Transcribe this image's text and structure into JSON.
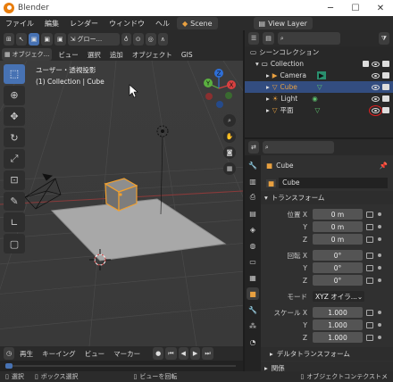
{
  "window": {
    "title": "Blender",
    "min": "─",
    "max": "☐",
    "close": "✕"
  },
  "menubar": {
    "items": [
      "ファイル",
      "編集",
      "レンダー",
      "ウィンドウ",
      "ヘル"
    ],
    "workspace": "Scene",
    "view_layer": "View Layer"
  },
  "viewport_header": {
    "transform_orientation": "グロー...",
    "mode": "オブジェク...",
    "menus": [
      "ビュー",
      "選択",
      "追加",
      "オブジェクト",
      "GIS"
    ]
  },
  "viewport": {
    "info_line1": "ユーザー・透視投影",
    "info_line2": "(1) Collection | Cube",
    "gizmo_x": "X",
    "gizmo_y": "Y",
    "gizmo_z": "Z"
  },
  "timeline": {
    "playback": "再生",
    "keying": "キーイング",
    "view": "ビュー",
    "marker": "マーカー"
  },
  "statusbar": {
    "select": "選択",
    "box_select": "ボックス選択",
    "rotate_view": "ビューを回転",
    "context_menu": "オブジェクトコンテクストメ"
  },
  "outliner": {
    "scene_collection": "シーンコレクション",
    "collection": "Collection",
    "items": [
      {
        "name": "Camera"
      },
      {
        "name": "Cube"
      },
      {
        "name": "Light"
      },
      {
        "name": "平面"
      }
    ]
  },
  "properties": {
    "object_name_header": "Cube",
    "object_name_field": "Cube",
    "transform_section": "トランスフォーム",
    "location_label": "位置 X",
    "rotation_label": "回転 X",
    "scale_label": "スケール X",
    "mode_label": "モード",
    "mode_value": "XYZ オイラ...",
    "y_label": "Y",
    "z_label": "Z",
    "location": [
      "0 m",
      "0 m",
      "0 m"
    ],
    "rotation": [
      "0°",
      "0°",
      "0°"
    ],
    "scale": [
      "1.000",
      "1.000",
      "1.000"
    ],
    "delta_section": "デルタトランスフォーム",
    "relations_section": "関係"
  },
  "colors": {
    "accent": "#4772b3",
    "selected_row": "#334d80",
    "highlight_box": "#e02020",
    "cube_outline": "#f0a030",
    "object_orange": "#e8a040",
    "data_green": "#5dc06e"
  }
}
